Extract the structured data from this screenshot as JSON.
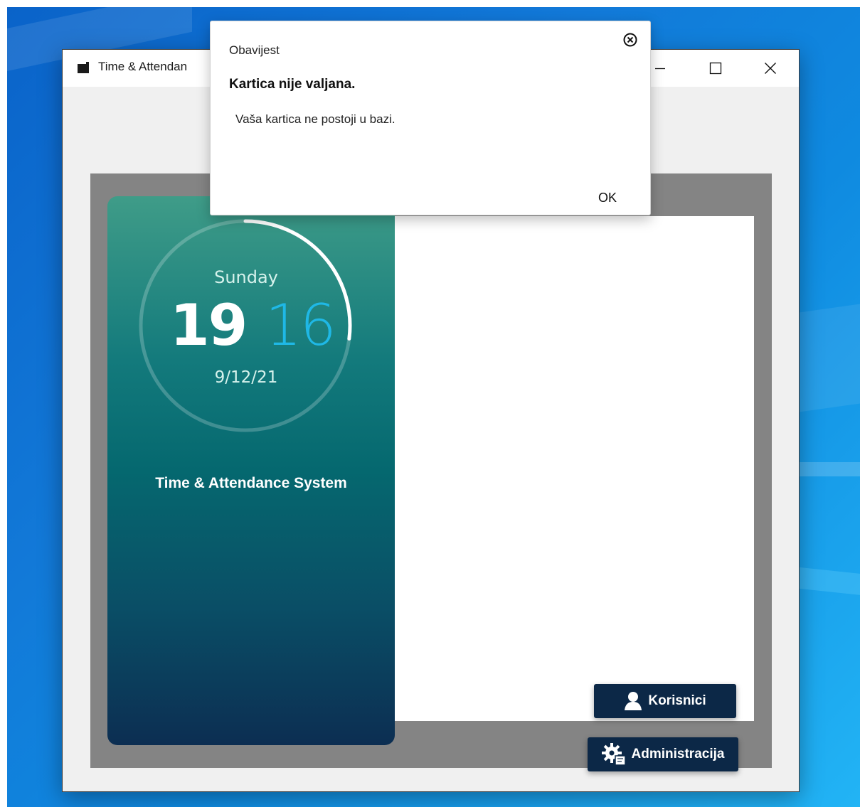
{
  "window": {
    "title": "Time & Attendan",
    "controls": [
      "minimize",
      "maximize",
      "close"
    ]
  },
  "clock": {
    "day": "Sunday",
    "hour": "19",
    "minute": "16",
    "date": "9/12/21",
    "seconds_progress": 0.27
  },
  "system_name": "Time & Attendance System",
  "buttons": {
    "users": {
      "label": "Korisnici",
      "icon": "user-icon"
    },
    "admin": {
      "label": "Administracija",
      "icon": "gear-icon"
    }
  },
  "dialog": {
    "caption": "Obavijest",
    "heading": "Kartica nije valjana.",
    "message": "Vaša kartica ne postoji u bazi.",
    "ok_label": "OK"
  },
  "colors": {
    "button_bg": "#0c2847",
    "minute_accent": "#1fb8e6",
    "frame_gray": "#848484"
  }
}
